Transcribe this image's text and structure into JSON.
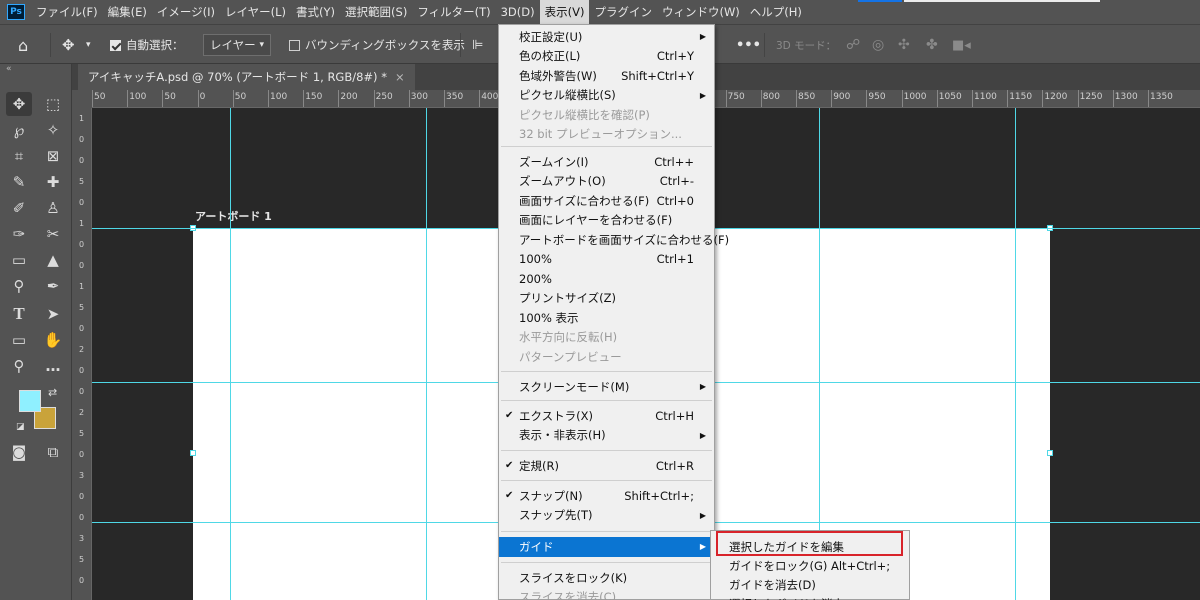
{
  "menubar": {
    "logo": "Ps",
    "items": [
      "ファイル(F)",
      "編集(E)",
      "イメージ(I)",
      "レイヤー(L)",
      "書式(Y)",
      "選択範囲(S)",
      "フィルター(T)",
      "3D(D)",
      "表示(V)",
      "プラグイン",
      "ウィンドウ(W)",
      "ヘルプ(H)"
    ],
    "active_index": 8
  },
  "optionsbar": {
    "auto_select_label": "自動選択：",
    "auto_select_value": "レイヤー",
    "bbox_label": "バウンディングボックスを表示",
    "more": "•••",
    "mode_3d_label": "3D モード："
  },
  "tab": {
    "title": "アイキャッチA.psd @ 70% (アートボード 1, RGB/8#) *",
    "close": "×"
  },
  "ruler_h": [
    "50",
    "100",
    "50",
    "0",
    "50",
    "100",
    "150",
    "200",
    "250",
    "300",
    "350",
    "400",
    "450",
    "500",
    "550",
    "600",
    "650",
    "700",
    "750",
    "800",
    "850",
    "900",
    "950",
    "1000",
    "1050",
    "1100",
    "1150",
    "1200",
    "1250",
    "1300",
    "1350"
  ],
  "ruler_v": [
    "1",
    "0",
    "0",
    "5",
    "0",
    "1",
    "0",
    "0",
    "1",
    "5",
    "0",
    "2",
    "0",
    "0",
    "2",
    "5",
    "0",
    "3",
    "0",
    "0",
    "3",
    "5",
    "0"
  ],
  "artboard": {
    "label": "アートボード 1"
  },
  "colors": {
    "foreground": "#8ff0ff",
    "background": "#c9a33a",
    "highlight": "#0b75d2",
    "guide": "#4fd8e6",
    "callout": "#d8232a"
  },
  "view_menu": {
    "items": [
      {
        "label": "校正設定(U)",
        "shortcut": "",
        "submenu": true
      },
      {
        "label": "色の校正(L)",
        "shortcut": "Ctrl+Y"
      },
      {
        "label": "色域外警告(W)",
        "shortcut": "Shift+Ctrl+Y"
      },
      {
        "label": "ピクセル縦横比(S)",
        "shortcut": "",
        "submenu": true
      },
      {
        "label": "ピクセル縦横比を確認(P)",
        "shortcut": "",
        "disabled": true
      },
      {
        "label": "32 bit プレビューオプション...",
        "shortcut": "",
        "disabled": true
      },
      {
        "label": "ズームイン(I)",
        "shortcut": "Ctrl++"
      },
      {
        "label": "ズームアウト(O)",
        "shortcut": "Ctrl+-"
      },
      {
        "label": "画面サイズに合わせる(F)",
        "shortcut": "Ctrl+0"
      },
      {
        "label": "画面にレイヤーを合わせる(F)",
        "shortcut": ""
      },
      {
        "label": "アートボードを画面サイズに合わせる(F)",
        "shortcut": ""
      },
      {
        "label": "100%",
        "shortcut": "Ctrl+1"
      },
      {
        "label": "200%",
        "shortcut": ""
      },
      {
        "label": "プリントサイズ(Z)",
        "shortcut": ""
      },
      {
        "label": "100% 表示",
        "shortcut": ""
      },
      {
        "label": "水平方向に反転(H)",
        "shortcut": "",
        "disabled": true
      },
      {
        "label": "パターンプレビュー",
        "shortcut": "",
        "disabled": true
      },
      {
        "label": "スクリーンモード(M)",
        "shortcut": "",
        "submenu": true
      },
      {
        "label": "エクストラ(X)",
        "shortcut": "Ctrl+H",
        "checked": true
      },
      {
        "label": "表示・非表示(H)",
        "shortcut": "",
        "submenu": true
      },
      {
        "label": "定規(R)",
        "shortcut": "Ctrl+R",
        "checked": true
      },
      {
        "label": "スナップ(N)",
        "shortcut": "Shift+Ctrl+;",
        "checked": true
      },
      {
        "label": "スナップ先(T)",
        "shortcut": "",
        "submenu": true
      },
      {
        "label": "ガイド",
        "shortcut": "",
        "submenu": true,
        "highlighted": true
      },
      {
        "label": "スライスをロック(K)",
        "shortcut": ""
      },
      {
        "label": "スライスを消去(C)",
        "shortcut": "",
        "disabled": true
      }
    ]
  },
  "guide_submenu": {
    "items": [
      {
        "label": "選択したガイドを編集",
        "shortcut": ""
      },
      {
        "label": "ガイドをロック(G)",
        "shortcut": "Alt+Ctrl+;"
      },
      {
        "label": "ガイドを消去(D)",
        "shortcut": ""
      },
      {
        "label": "選択したガイドを消去",
        "shortcut": ""
      }
    ]
  }
}
